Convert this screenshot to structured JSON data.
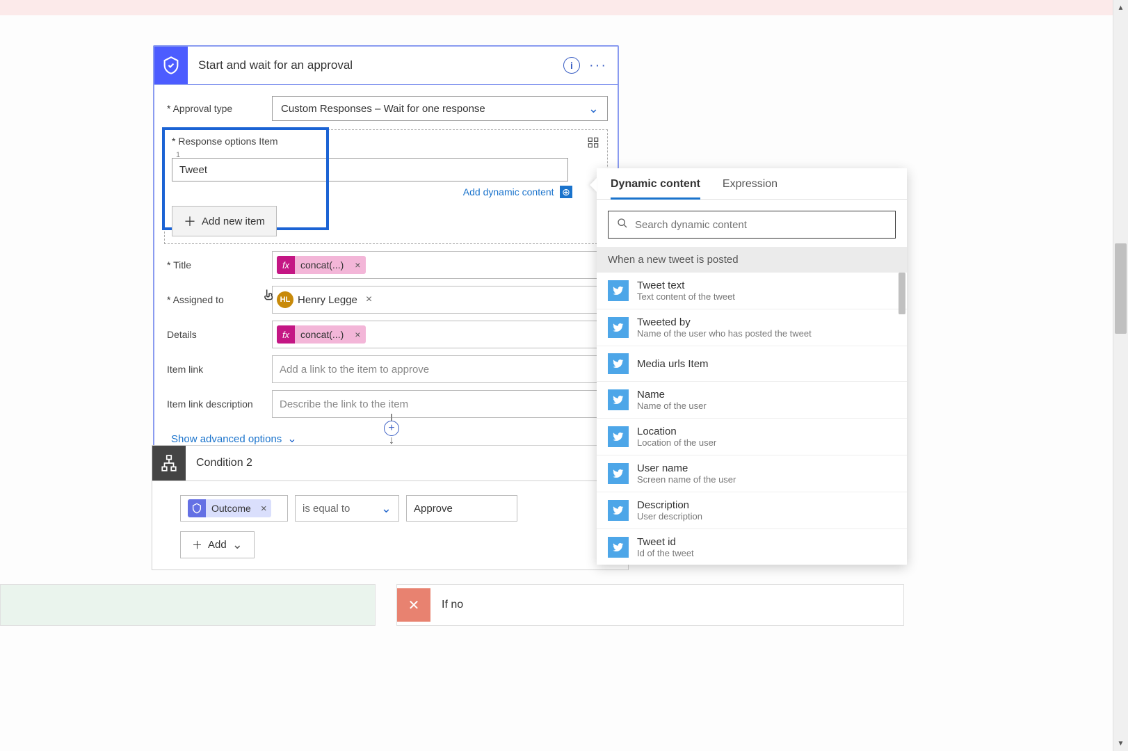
{
  "approval_card": {
    "title": "Start and wait for an approval",
    "fields": {
      "approval_type": {
        "label": "Approval type",
        "value": "Custom Responses – Wait for one response"
      },
      "response_options": {
        "label": "Response options Item",
        "item_index": "1",
        "value": "Tweet",
        "add_dynamic": "Add dynamic content",
        "add_new_item": "Add new item"
      },
      "title": {
        "label": "Title",
        "fx_text": "concat(...)"
      },
      "assigned_to": {
        "label": "Assigned to",
        "user_initials": "HL",
        "user_name": "Henry Legge"
      },
      "details": {
        "label": "Details",
        "fx_text": "concat(...)"
      },
      "item_link": {
        "label": "Item link",
        "placeholder": "Add a link to the item to approve"
      },
      "item_link_desc": {
        "label": "Item link description",
        "placeholder": "Describe the link to the item"
      }
    },
    "show_advanced": "Show advanced options"
  },
  "condition_card": {
    "title": "Condition 2",
    "outcome_label": "Outcome",
    "operator": "is equal to",
    "value": "Approve",
    "add_button": "Add"
  },
  "dynamic_panel": {
    "tabs": {
      "dynamic": "Dynamic content",
      "expression": "Expression"
    },
    "search_placeholder": "Search dynamic content",
    "section_header": "When a new tweet is posted",
    "items": [
      {
        "title": "Tweet text",
        "desc": "Text content of the tweet"
      },
      {
        "title": "Tweeted by",
        "desc": "Name of the user who has posted the tweet"
      },
      {
        "title": "Media urls Item",
        "desc": ""
      },
      {
        "title": "Name",
        "desc": "Name of the user"
      },
      {
        "title": "Location",
        "desc": "Location of the user"
      },
      {
        "title": "User name",
        "desc": "Screen name of the user"
      },
      {
        "title": "Description",
        "desc": "User description"
      },
      {
        "title": "Tweet id",
        "desc": "Id of the tweet"
      }
    ]
  },
  "branch_no": {
    "label": "If no"
  }
}
